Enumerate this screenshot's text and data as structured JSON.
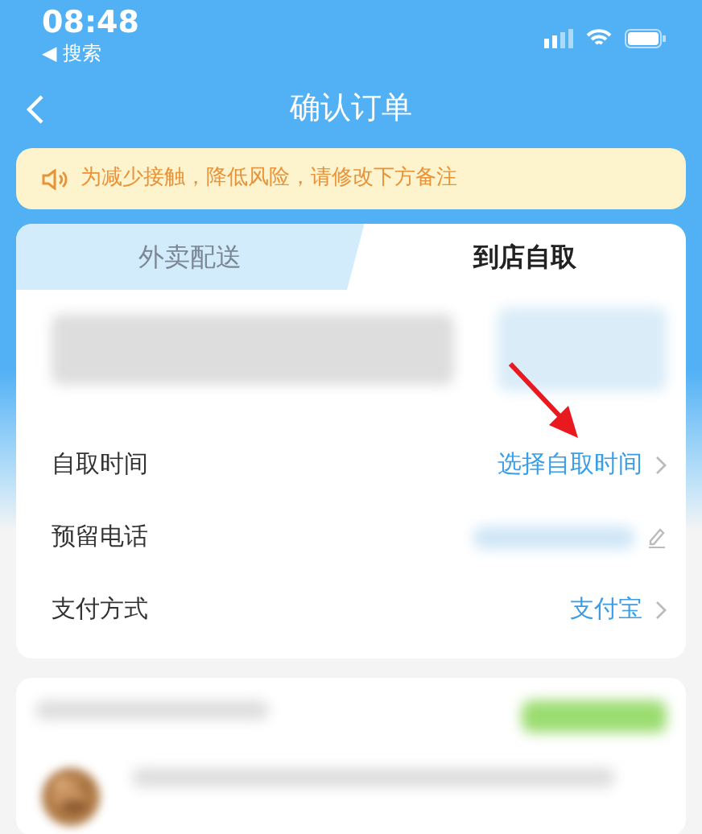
{
  "status_bar": {
    "time": "08:48",
    "back_app": "◀ 搜索"
  },
  "nav": {
    "title": "确认订单"
  },
  "notice": {
    "text": "为减少接触，降低风险，请修改下方备注"
  },
  "tabs": [
    {
      "label": "外卖配送",
      "selected": false
    },
    {
      "label": "到店自取",
      "selected": true
    }
  ],
  "rows": [
    {
      "label": "自取时间",
      "kind": "link",
      "value": "选择自取时间"
    },
    {
      "label": "预留电话",
      "kind": "edit"
    },
    {
      "label": "支付方式",
      "kind": "link",
      "value": "支付宝"
    }
  ]
}
